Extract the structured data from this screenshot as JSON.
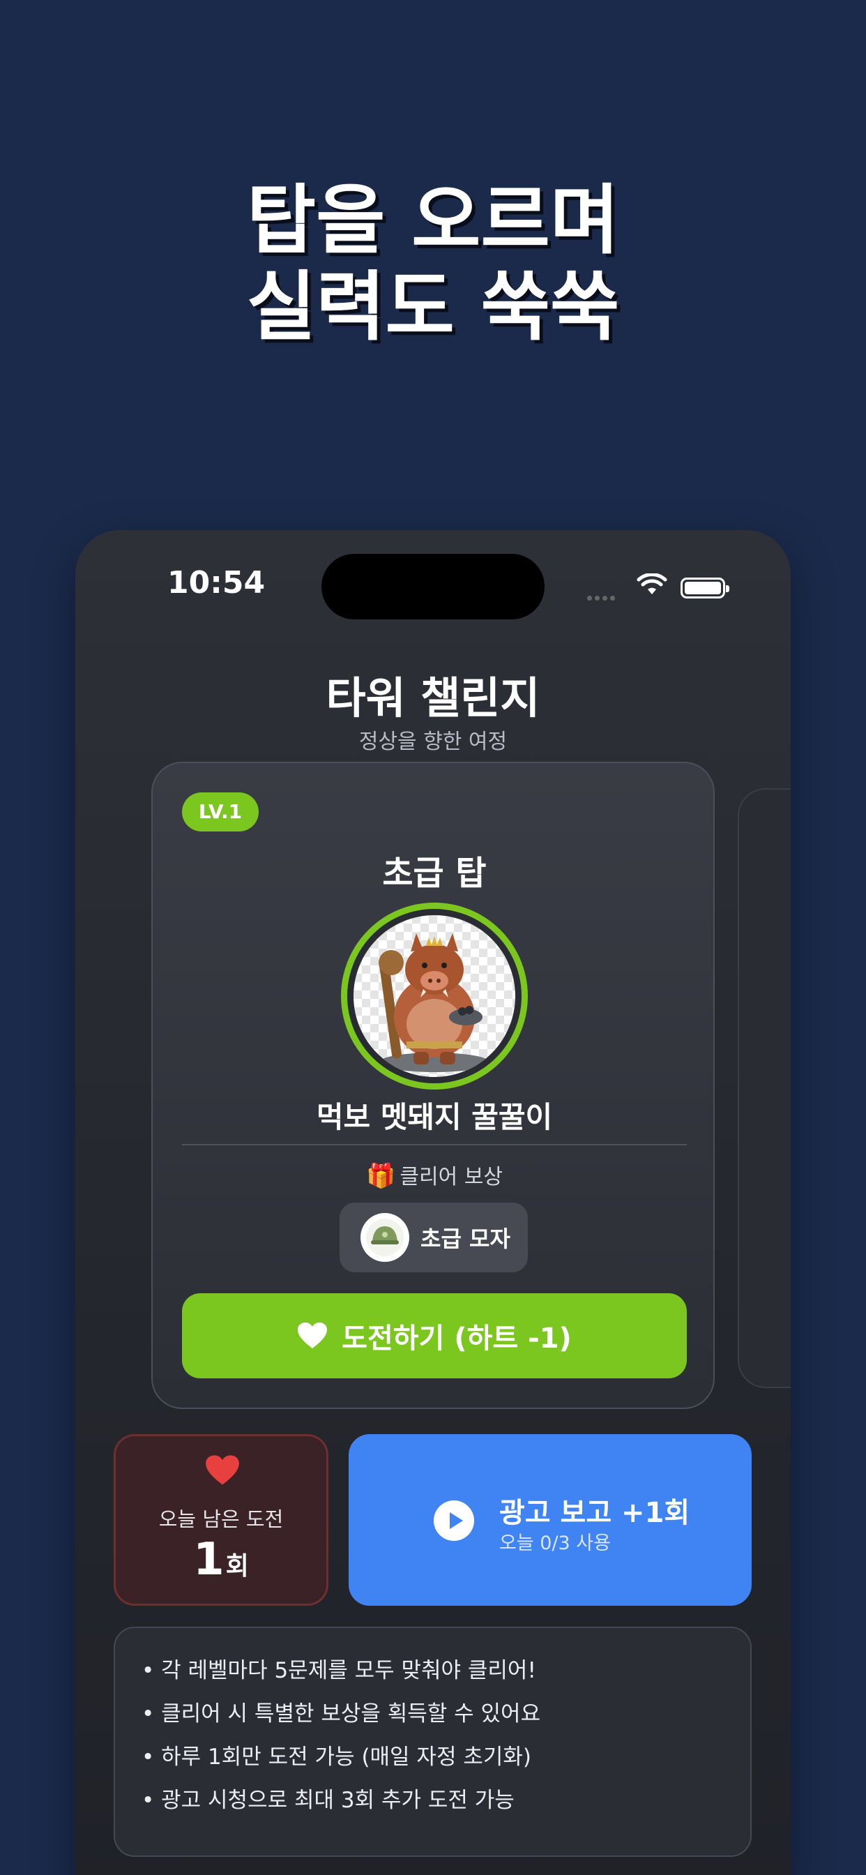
{
  "headline": {
    "line1": "탑을 오르며",
    "line2": "실력도 쑥쑥"
  },
  "status_bar": {
    "time": "10:54"
  },
  "app": {
    "title": "타워 챌린지",
    "subtitle": "정상을 향한 여정"
  },
  "tower_card": {
    "level_badge": "LV.1",
    "tower_name": "초급 탑",
    "monster_name": "먹보 멧돼지 꿀꿀이",
    "reward_label": "클리어 보상",
    "reward_item": "초급 모자",
    "challenge_button": "도전하기 (하트 -1)"
  },
  "remaining": {
    "label": "오늘 남은 도전",
    "count": "1",
    "unit": "회"
  },
  "ad": {
    "title": "광고 보고 +1회",
    "subtitle": "오늘 0/3 사용"
  },
  "rules": [
    "• 각 레벨마다 5문제를 모두 맞춰야 클리어!",
    "• 클리어 시 특별한 보상을 획득할 수 있어요",
    "• 하루 1회만 도전 가능 (매일 자정 초기화)",
    "• 광고 시청으로 최대 3회 추가 도전 가능"
  ],
  "colors": {
    "background": "#1b2a4b",
    "accent_green": "#7cc620",
    "ad_blue": "#3f84f2",
    "heart_red": "#e8403f"
  }
}
